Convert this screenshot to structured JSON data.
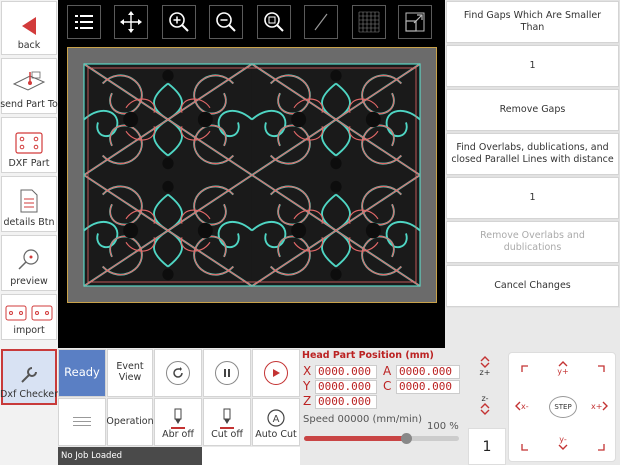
{
  "sidebar": {
    "items": [
      {
        "label": "back",
        "icon": "back-arrow-icon"
      },
      {
        "label": "send Part To",
        "icon": "send-part-icon"
      },
      {
        "label": "DXF Part",
        "icon": "dxf-part-icon"
      },
      {
        "label": "details Btn",
        "icon": "document-icon"
      },
      {
        "label": "preview",
        "icon": "preview-icon"
      },
      {
        "label": "import",
        "icon": "import-icon"
      },
      {
        "label": "Dxf Checker",
        "icon": "wrench-icon"
      }
    ]
  },
  "toolbar": {
    "tools": [
      "list-icon",
      "move-icon",
      "zoom-in-icon",
      "zoom-out-icon",
      "zoom-fit-icon",
      "line-icon",
      "grid-icon",
      "resize-icon"
    ]
  },
  "right_panel": {
    "find_gaps_label": "Find Gaps Which Are Smaller Than",
    "gap_value": "1",
    "remove_gaps_label": "Remove Gaps",
    "find_overlaps_label": "Find Overlabs, dublications, and closed Parallel Lines with distance",
    "overlap_value": "1",
    "remove_overlaps_label": "Remove Overlabs and dublications",
    "cancel_label": "Cancel Changes"
  },
  "controls": {
    "ready_label": "Ready",
    "event_view_label": "Event View",
    "operation_label": "Operation",
    "abr_off_label": "Abr off",
    "cut_off_label": "Cut off",
    "auto_cut_label": "Auto Cut"
  },
  "head_position": {
    "title": "Head Part Position (mm)",
    "x_label": "X",
    "x_value": "0000.000",
    "y_label": "Y",
    "y_value": "0000.000",
    "z_label": "Z",
    "z_value": "0000.000",
    "a_label": "A",
    "a_value": "0000.000",
    "c_label": "C",
    "c_value": "0000.000",
    "speed_label": "Speed 00000  (mm/min)",
    "speed_percent": "100 %",
    "speed_fraction": 0.66
  },
  "status": {
    "text": "No Job Loaded"
  },
  "z_control": {
    "z_up": "z+",
    "z_down": "z-",
    "step_value": "1"
  },
  "jog": {
    "y_plus": "y+",
    "y_minus": "y-",
    "x_plus": "x+",
    "x_minus": "x-",
    "step_label": "STEP"
  },
  "colors": {
    "accent_red": "#c43333",
    "ready_blue": "#5a7fc4",
    "canvas_bg": "#000000",
    "pattern_cyan": "#4fd6c4"
  }
}
